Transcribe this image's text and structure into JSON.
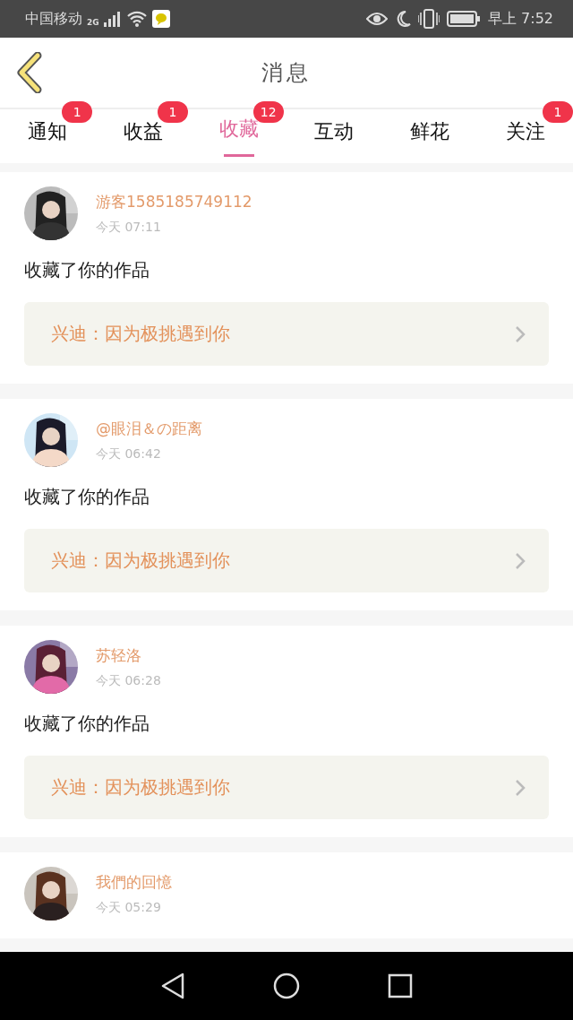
{
  "status_bar": {
    "carrier": "中国移动",
    "network": "2G",
    "time": "早上 7:52"
  },
  "header": {
    "title": "消息"
  },
  "tabs": [
    {
      "label": "通知",
      "selected": false,
      "badge": "1"
    },
    {
      "label": "收益",
      "selected": false,
      "badge": "1"
    },
    {
      "label": "收藏",
      "selected": true,
      "badge": "12"
    },
    {
      "label": "互动",
      "selected": false
    },
    {
      "label": "鲜花",
      "selected": false
    },
    {
      "label": "关注",
      "selected": false,
      "badge": "1"
    }
  ],
  "messages": [
    {
      "name": "游客1585185749112",
      "time": "今天 07:11",
      "action": "收藏了你的作品",
      "work": "兴迪：因为极挑遇到你"
    },
    {
      "name": "@眼泪＆の距离",
      "time": "今天 06:42",
      "action": "收藏了你的作品",
      "work": "兴迪：因为极挑遇到你"
    },
    {
      "name": "苏轻洛",
      "time": "今天 06:28",
      "action": "收藏了你的作品",
      "work": "兴迪：因为极挑遇到你"
    },
    {
      "name": "我們的回憶",
      "time": "今天 05:29"
    }
  ]
}
